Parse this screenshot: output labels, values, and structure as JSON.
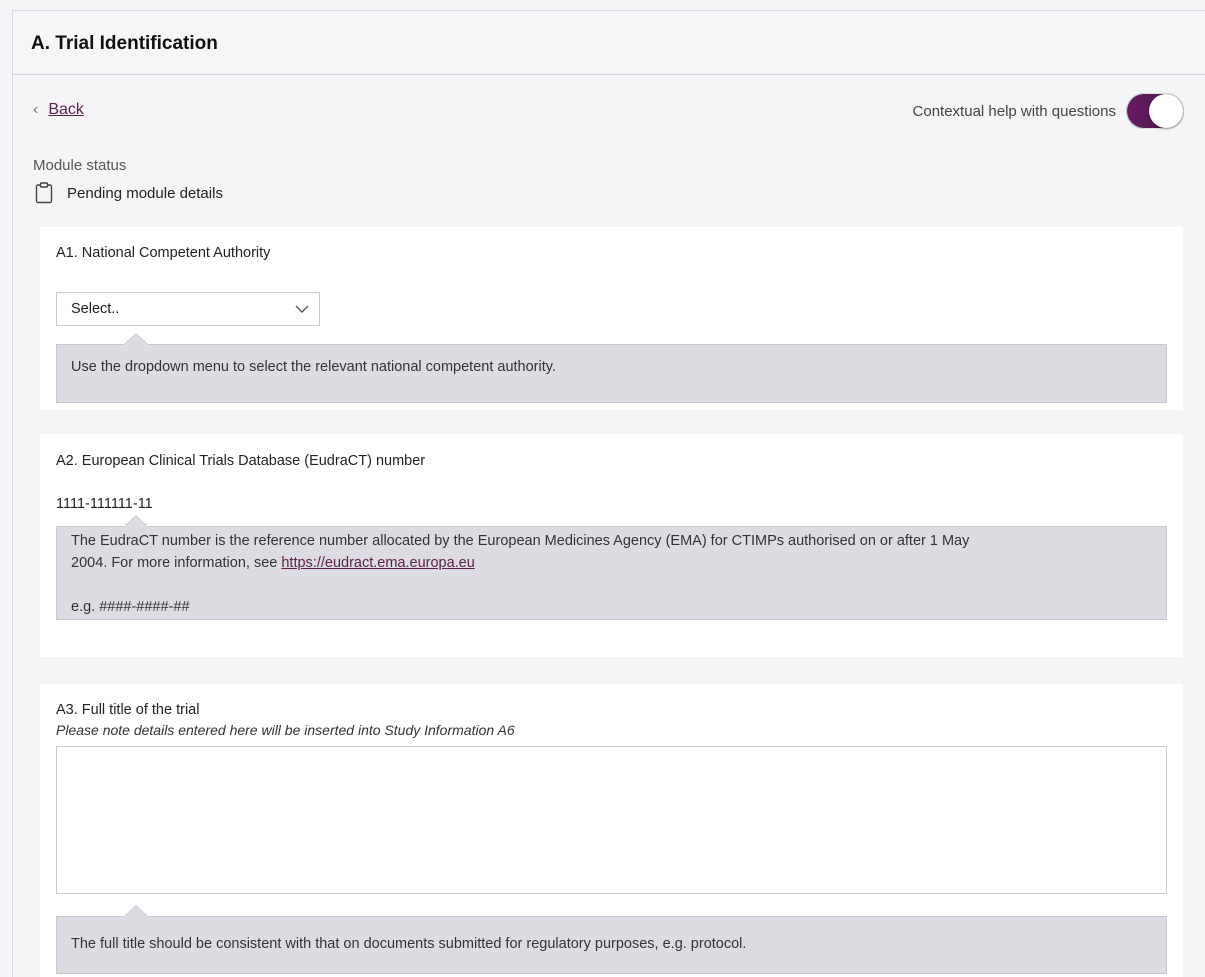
{
  "header": {
    "title": "A. Trial Identification"
  },
  "nav": {
    "back_label": "Back",
    "help_toggle_label": "Contextual help with questions",
    "help_toggle_on": true
  },
  "status": {
    "label": "Module status",
    "value": "Pending module details",
    "icon": "clipboard-icon"
  },
  "colors": {
    "accent": "#5b1f4a",
    "toggle": "#6b1b63",
    "help_bg": "#dcdce2"
  },
  "questions": {
    "a1": {
      "label": "A1. National Competent Authority",
      "select_value": "Select..",
      "help": "Use the dropdown menu to select the relevant national competent authority."
    },
    "a2": {
      "label": "A2. European Clinical Trials Database (EudraCT) number",
      "value": "1111-111111-11",
      "help_line1": "The EudraCT number is the reference number allocated by the European Medicines Agency (EMA) for CTIMPs authorised on or after 1 May",
      "help_line2_prefix": "2004. For more information, see ",
      "help_link": "https://eudract.ema.europa.eu",
      "help_example": "e.g. ####-####-##"
    },
    "a3": {
      "label": "A3. Full title of the trial",
      "note": "Please note details entered here will be inserted into Study Information A6",
      "value": "",
      "help": "The full title should be consistent with that on documents submitted for regulatory purposes, e.g. protocol."
    }
  }
}
